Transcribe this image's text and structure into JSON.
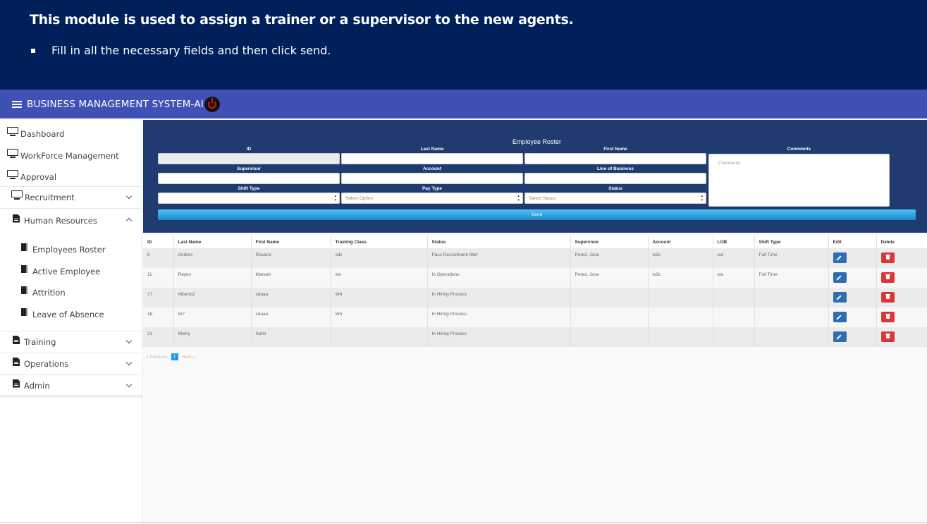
{
  "slide": {
    "title": "This module is used to assign a trainer or a supervisor to the new agents.",
    "bullet": "Fill in all the necessary fields and then click send."
  },
  "app": {
    "title": "BUSINESS MANAGEMENT SYSTEM-AI",
    "accent": "#3f51b5",
    "header_bg": "#00205b"
  },
  "sidebar": {
    "items": [
      {
        "label": "Dashboard",
        "icon": "monitor-icon"
      },
      {
        "label": "WorkForce Management",
        "icon": "monitor-icon"
      },
      {
        "label": "Approval",
        "icon": "monitor-icon"
      },
      {
        "label": "Recruitment",
        "icon": "monitor-icon",
        "expanded": false
      },
      {
        "label": "Human Resources",
        "icon": "document-icon",
        "expanded": true,
        "children": [
          "Employees Roster",
          "Active Employee",
          "Attrition",
          "Leave of Absence"
        ]
      },
      {
        "label": "Training",
        "icon": "document-icon",
        "expanded": false
      },
      {
        "label": "Operations",
        "icon": "document-icon",
        "expanded": false
      },
      {
        "label": "Admin",
        "icon": "document-icon",
        "expanded": false
      }
    ]
  },
  "form": {
    "title": "Employee Roster",
    "labels": {
      "id": "ID",
      "last_name": "Last Name",
      "first_name": "First Name",
      "comments": "Comments",
      "supervisor": "Supervisor",
      "account": "Account",
      "lob": "Line of Business",
      "shift_type": "Shift Type",
      "pay_type": "Pay Type",
      "status": "Status"
    },
    "placeholders": {
      "comments": "Comments",
      "pay_type": "Select Option",
      "status": "Select Status"
    },
    "send_label": "Send"
  },
  "table": {
    "headers": [
      "ID",
      "Last Name",
      "First Name",
      "Training Class",
      "Status",
      "Supervisor",
      "Account",
      "LOB",
      "Shift Type",
      "Edit",
      "Delete"
    ],
    "rows": [
      [
        "6",
        "Andres",
        "Rosario",
        "sds",
        "Pass Recruitment filter",
        "Perez, Jose",
        "w3c",
        "wa",
        "Full Time"
      ],
      [
        "11",
        "Reyes",
        "Manuel",
        "we",
        "In Operations",
        "Perez, Jose",
        "w3c",
        "wa",
        "Full Time"
      ],
      [
        "17",
        "Alberto2",
        "sdaaa",
        "W4",
        "In Hiring Process",
        "",
        "",
        "",
        ""
      ],
      [
        "18",
        "W7",
        "sdaaa",
        "W4",
        "In Hiring Process",
        "",
        "",
        "",
        ""
      ],
      [
        "21",
        "Mistry",
        "Sahil",
        "",
        "In Hiring Process",
        "",
        "",
        "",
        ""
      ]
    ]
  },
  "pagination": {
    "previous": "« Previous",
    "current": "1",
    "next": "Next »"
  }
}
